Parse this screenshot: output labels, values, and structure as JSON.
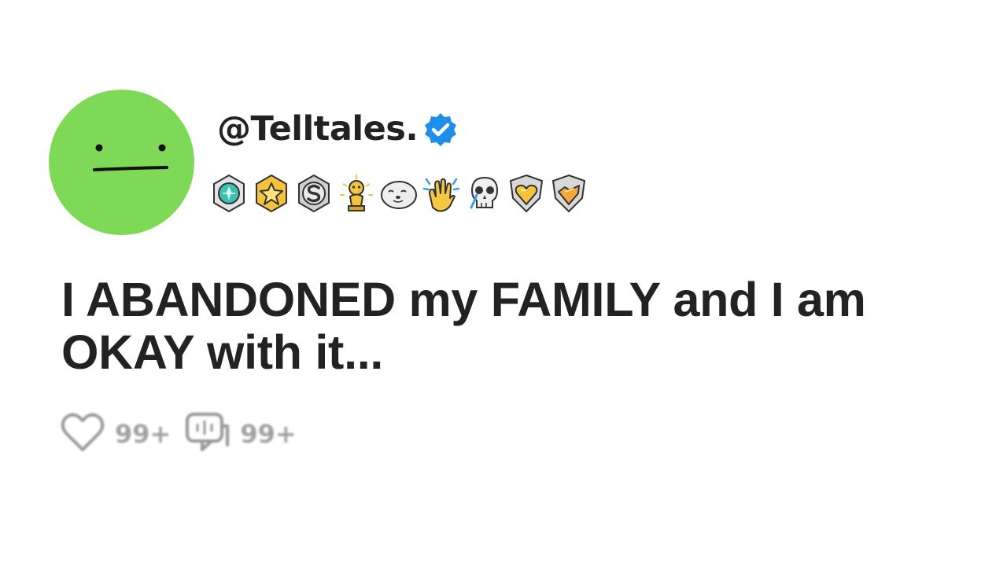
{
  "post": {
    "username": "@Telltales.",
    "verified": true,
    "avatar_color": "#7ed957",
    "verified_color": "#1d8fe8",
    "awards": [
      "diamond-medal-icon",
      "gold-star-medal-icon",
      "silver-s-medal-icon",
      "gold-trophy-icon",
      "seal-icon",
      "clapping-hands-icon",
      "crying-skull-icon",
      "gold-heart-shield-icon",
      "gold-fire-shield-icon"
    ],
    "title": "I ABANDONED my FAMILY and I am OKAY with it...",
    "likes": "99+",
    "comments": "99+"
  }
}
